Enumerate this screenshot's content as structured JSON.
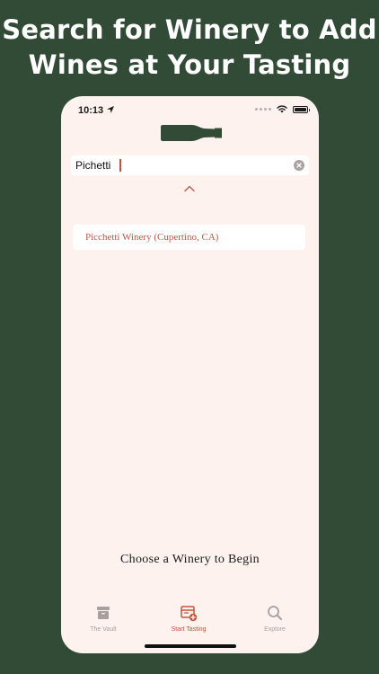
{
  "headline": {
    "line1": "Search for Winery to Add",
    "line2": "Wines at Your Tasting"
  },
  "status_bar": {
    "time": "10:13"
  },
  "search": {
    "value": "Pichetti"
  },
  "results": [
    {
      "label": "Picchetti Winery (Cupertino, CA)"
    }
  ],
  "prompt": "Choose a Winery to Begin",
  "tabs": [
    {
      "label": "The Vault",
      "icon": "archive-box-icon"
    },
    {
      "label": "Start Tasting",
      "icon": "tasting-card-plus-icon"
    },
    {
      "label": "Explore",
      "icon": "magnifying-glass-icon"
    }
  ],
  "colors": {
    "background": "#314b36",
    "phone": "#fdf2ee",
    "accent": "#c0553f",
    "inactive": "#a8a09c"
  }
}
